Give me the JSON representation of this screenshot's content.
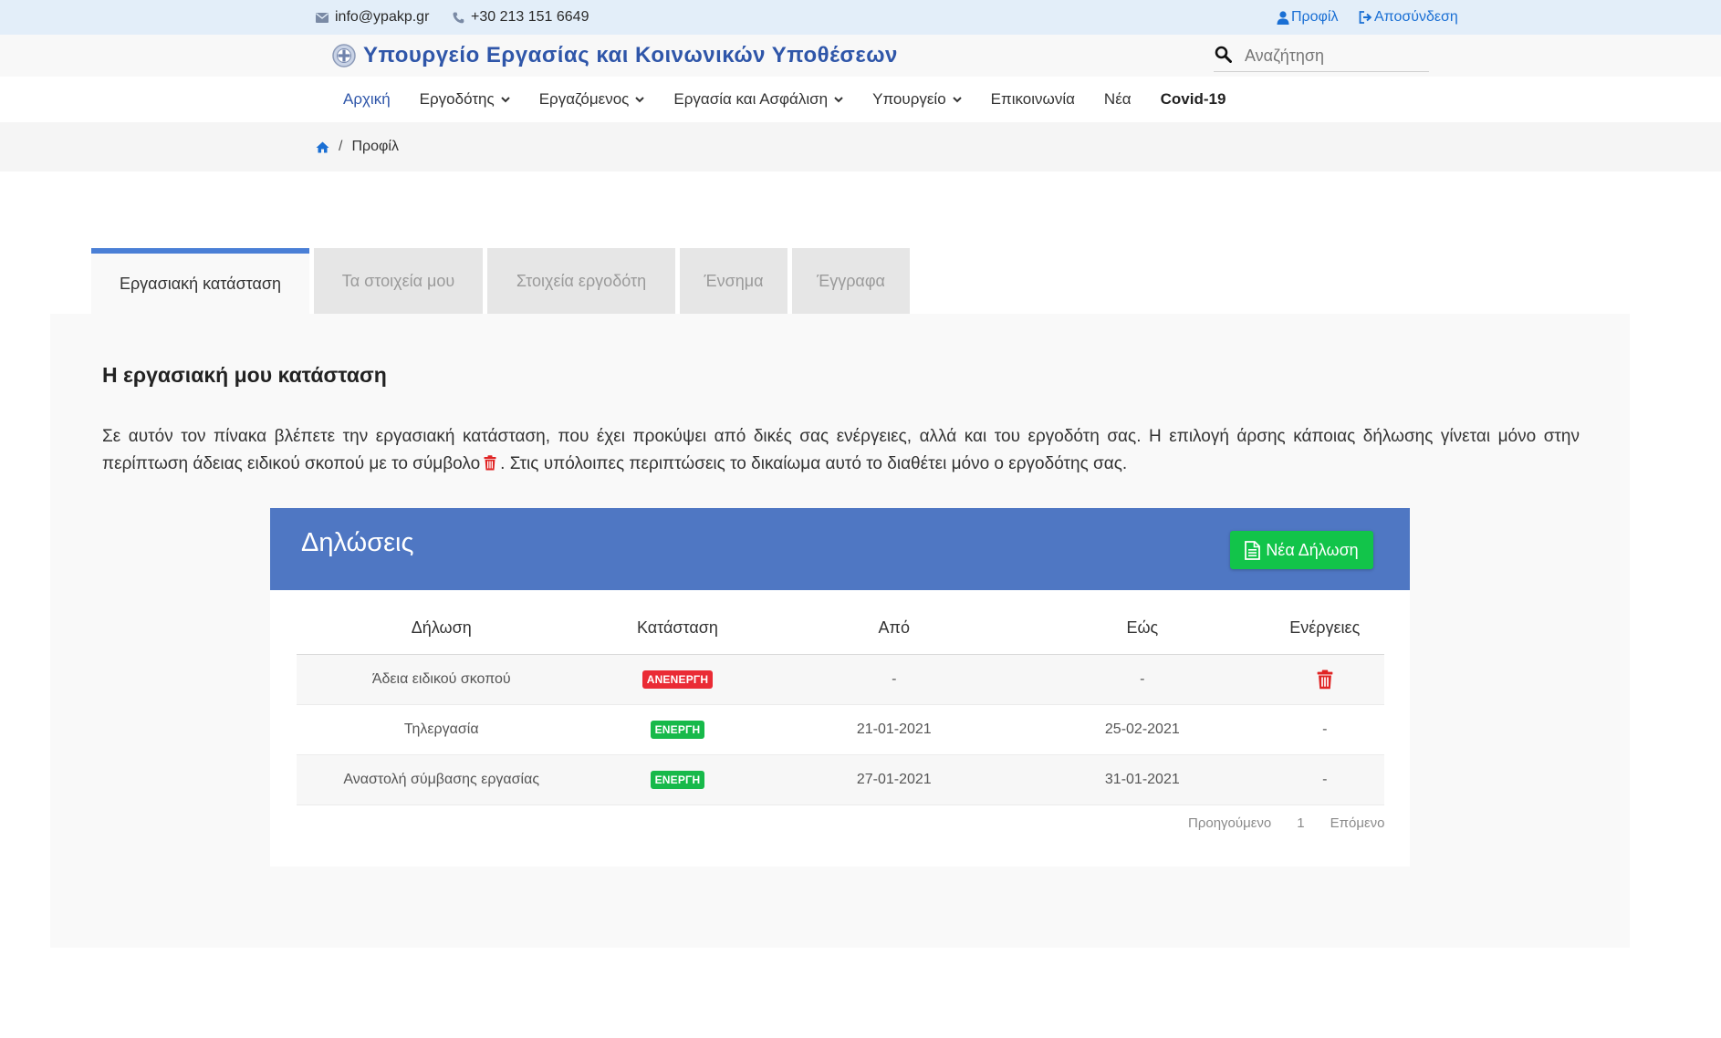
{
  "topbar": {
    "email": "info@ypakp.gr",
    "phone": "+30 213 151 6649",
    "profile_label": "Προφίλ",
    "logout_label": "Αποσύνδεση"
  },
  "brand": {
    "title": "Υπουργείο Εργασίας και Κοινωνικών Υποθέσεων"
  },
  "search": {
    "placeholder": "Αναζήτηση"
  },
  "nav": {
    "items": [
      {
        "label": "Αρχική"
      },
      {
        "label": "Εργοδότης"
      },
      {
        "label": "Εργαζόμενος"
      },
      {
        "label": "Εργασία και Ασφάλιση"
      },
      {
        "label": "Υπουργείο"
      },
      {
        "label": "Επικοινωνία"
      },
      {
        "label": "Νέα"
      },
      {
        "label": "Covid-19"
      }
    ]
  },
  "breadcrumb": {
    "separator": "/",
    "current": "Προφίλ"
  },
  "tabs": [
    {
      "label": "Εργασιακή κατάσταση"
    },
    {
      "label": "Τα στοιχεία μου"
    },
    {
      "label": "Στοιχεία εργοδότη"
    },
    {
      "label": "Ένσημα"
    },
    {
      "label": "Έγγραφα"
    }
  ],
  "main": {
    "heading": "Η εργασιακή μου κατάσταση",
    "desc_part1": "Σε αυτόν τον πίνακα βλέπετε την εργασιακή κατάσταση, που έχει προκύψει από δικές σας ενέργειες, αλλά και του εργοδότη σας. Η επιλογή άρσης κάποιας δήλωσης γίνεται μόνο στην περίπτωση άδειας ειδικού σκοπού με το σύμβολο",
    "desc_part2": ". Στις υπόλοιπες περιπτώσεις το δικαίωμα αυτό το διαθέτει μόνο ο εργοδότης σας."
  },
  "card": {
    "title": "Δηλώσεις",
    "new_button": "Νέα Δήλωση",
    "columns": [
      "Δήλωση",
      "Κατάσταση",
      "Από",
      "Εώς",
      "Ενέργειες"
    ],
    "rows": [
      {
        "declaration": "Άδεια ειδικού σκοπού",
        "status": "ΑΝΕΝΕΡΓΗ",
        "from": "-",
        "to": "-",
        "action": "delete-icon"
      },
      {
        "declaration": "Τηλεργασία",
        "status": "ΕΝΕΡΓΗ",
        "from": "21-01-2021",
        "to": "25-02-2021",
        "action": "-"
      },
      {
        "declaration": "Αναστολή σύμβασης εργασίας",
        "status": "ΕΝΕΡΓΗ",
        "from": "27-01-2021",
        "to": "31-01-2021",
        "action": "-"
      }
    ],
    "pager": {
      "prev": "Προηγούμενο",
      "page": "1",
      "next": "Επόμενο"
    }
  },
  "colors": {
    "brand_blue": "#2f56a9",
    "card_header": "#4f77c3",
    "tab_accent": "#4a7fd6",
    "button_green": "#12c44a",
    "badge_red": "#ea2b35",
    "badge_green": "#17b94a",
    "link_blue": "#1a6fd4"
  }
}
